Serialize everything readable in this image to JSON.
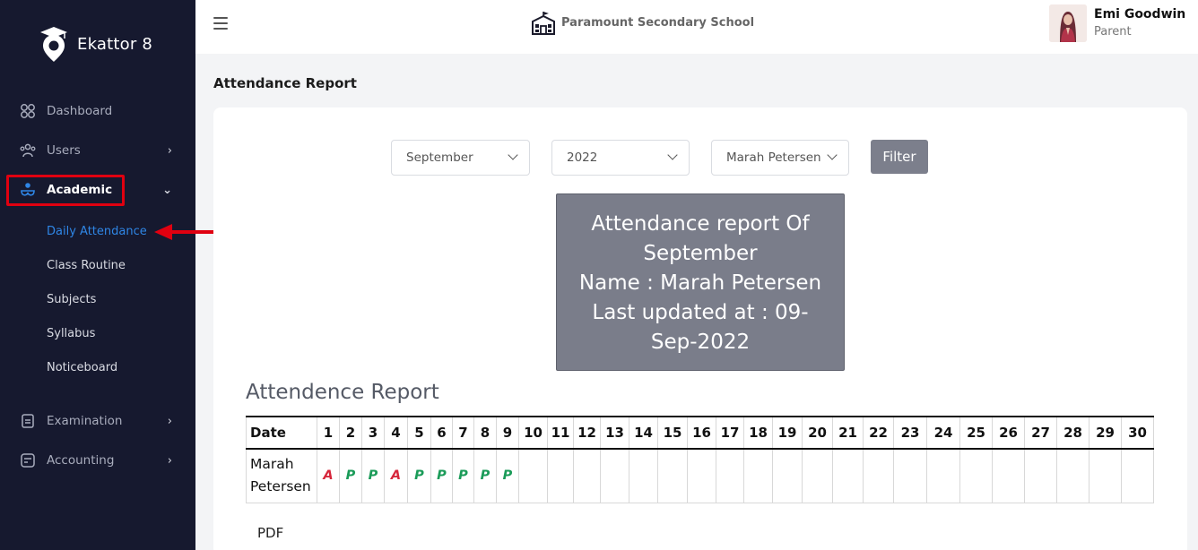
{
  "sidebar": {
    "brand": "Ekattor 8",
    "items": [
      {
        "label": "Dashboard",
        "icon": "grid-icon"
      },
      {
        "label": "Users",
        "icon": "users-icon"
      },
      {
        "label": "Academic",
        "icon": "academic-icon"
      },
      {
        "label": "Examination",
        "icon": "exam-icon"
      },
      {
        "label": "Accounting",
        "icon": "accounting-icon"
      }
    ],
    "academic_sub": [
      "Daily Attendance",
      "Class Routine",
      "Subjects",
      "Syllabus",
      "Noticeboard"
    ]
  },
  "header": {
    "school_name": "Paramount Secondary School",
    "user_name": "Emi Goodwin",
    "user_role": "Parent"
  },
  "main": {
    "page_title": "Attendance Report",
    "filters": {
      "month": "September",
      "year": "2022",
      "student": "Marah Petersen",
      "filter_label": "Filter"
    },
    "report_box": {
      "line1": "Attendance report Of September",
      "line2": "Name : Marah Petersen",
      "line3": "Last updated at : 09-Sep-2022"
    },
    "section_title": "Attendence Report",
    "table": {
      "date_header": "Date",
      "days": [
        "1",
        "2",
        "3",
        "4",
        "5",
        "6",
        "7",
        "8",
        "9",
        "10",
        "11",
        "12",
        "13",
        "14",
        "15",
        "16",
        "17",
        "18",
        "19",
        "20",
        "21",
        "22",
        "23",
        "24",
        "25",
        "26",
        "27",
        "28",
        "29",
        "30"
      ],
      "student": "Marah Petersen",
      "marks": [
        "A",
        "P",
        "P",
        "A",
        "P",
        "P",
        "P",
        "P",
        "P",
        "",
        "",
        "",
        "",
        "",
        "",
        "",
        "",
        "",
        "",
        "",
        "",
        "",
        "",
        "",
        "",
        "",
        "",
        "",
        "",
        ""
      ]
    },
    "pdf_label": "PDF"
  },
  "colors": {
    "sidebar_bg": "#16192f",
    "absent": "#d6263b",
    "present": "#1a9b58",
    "active_link": "#2f86e6",
    "highlight_red": "#e00010"
  }
}
